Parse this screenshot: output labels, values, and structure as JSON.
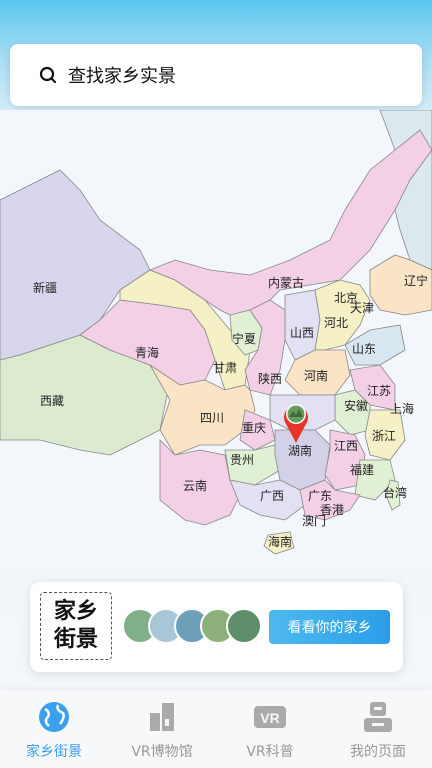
{
  "search": {
    "placeholder_text": "查找家乡实景",
    "icon": "search-icon"
  },
  "map": {
    "provinces": {
      "xinjiang": "新疆",
      "xizang": "西藏",
      "qinghai": "青海",
      "gansu": "甘肃",
      "ningxia": "宁夏",
      "neimenggu": "内蒙古",
      "shanxi_jin": "山西",
      "shaanxi": "陕西",
      "sichuan": "四川",
      "chongqing": "重庆",
      "guizhou": "贵州",
      "yunnan": "云南",
      "guangxi": "广西",
      "guangdong": "广东",
      "hunan": "湖南",
      "hubei_hidden": "",
      "henan": "河南",
      "hebei": "河北",
      "beijing": "北京",
      "tianjin": "天津",
      "liaoning": "辽宁",
      "shandong": "山东",
      "jiangsu": "江苏",
      "anhui": "安徽",
      "shanghai": "上海",
      "zhejiang": "浙江",
      "jiangxi": "江西",
      "fujian": "福建",
      "taiwan": "台湾",
      "xianggang": "香港",
      "aomen": "澳门",
      "hainan": "海南"
    },
    "pin_icon": "location-pin-icon"
  },
  "banner": {
    "logo_line1": "家乡",
    "logo_line2": "街景",
    "cta_label": "看看你的家乡"
  },
  "tabbar": {
    "tabs": [
      {
        "label": "家乡街景",
        "icon": "globe-icon",
        "active": true
      },
      {
        "label": "VR博物馆",
        "icon": "museum-icon",
        "active": false
      },
      {
        "label": "VR科普",
        "icon": "vr-icon",
        "active": false
      },
      {
        "label": "我的页面",
        "icon": "user-icon",
        "active": false
      }
    ]
  },
  "colors": {
    "accent": "#3b9ff0",
    "inactive": "#999999"
  }
}
